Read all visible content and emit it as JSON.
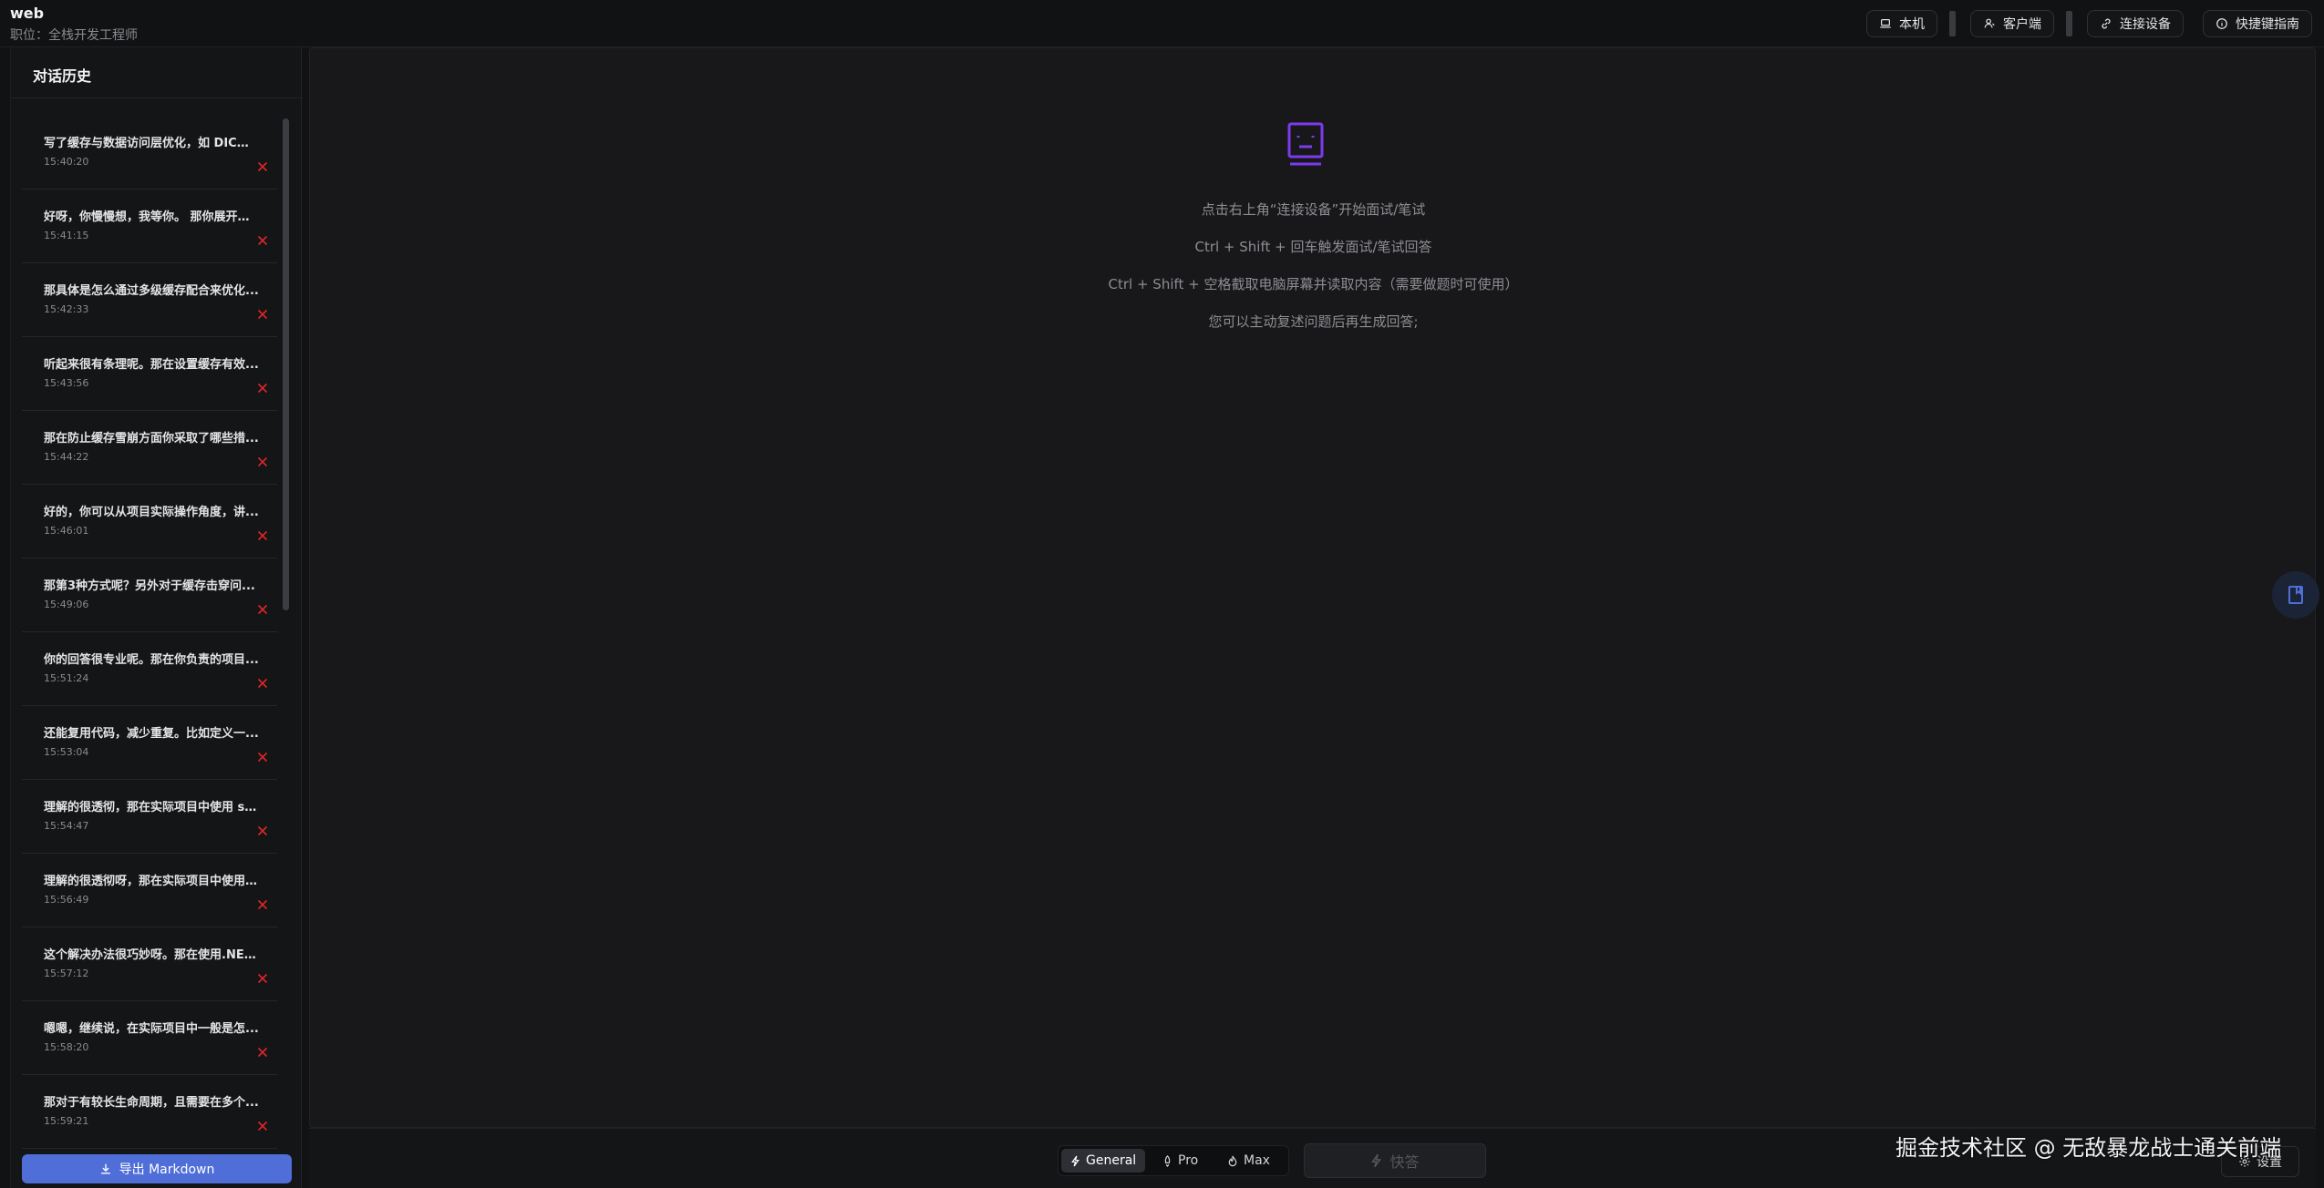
{
  "header": {
    "app_title": "web",
    "job_title": "职位：全栈开发工程师",
    "buttons": {
      "local": "本机",
      "client": "客户端",
      "connect": "连接设备",
      "shortcuts": "快捷键指南"
    }
  },
  "sidebar": {
    "title": "对话历史",
    "items": [
      {
        "text": "写了缓存与数据访问层优化，如 DICM...",
        "time": "15:40:20"
      },
      {
        "text": "好呀，你慢慢想，我等你。 那你展开说...",
        "time": "15:41:15"
      },
      {
        "text": "那具体是怎么通过多级缓存配合来优化...",
        "time": "15:42:33"
      },
      {
        "text": "听起来很有条理呢。那在设置缓存有效...",
        "time": "15:43:56"
      },
      {
        "text": "那在防止缓存雪崩方面你采取了哪些措...",
        "time": "15:44:22"
      },
      {
        "text": "好的，你可以从项目实际操作角度，讲...",
        "time": "15:46:01"
      },
      {
        "text": "那第3种方式呢？另外对于缓存击穿问...",
        "time": "15:49:06"
      },
      {
        "text": "你的回答很专业呢。那在你负责的项目...",
        "time": "15:51:24"
      },
      {
        "text": "还能复用代码，减少重复。比如定义一...",
        "time": "15:53:04"
      },
      {
        "text": "理解的很透彻，那在实际项目中使用 s t...",
        "time": "15:54:47"
      },
      {
        "text": "理解的很透彻呀，那在实际项目中使用 ...",
        "time": "15:56:49"
      },
      {
        "text": "这个解决办法很巧妙呀。那在使用.NET ...",
        "time": "15:57:12"
      },
      {
        "text": "嗯嗯，继续说，在实际项目中一般是怎...",
        "time": "15:58:20"
      },
      {
        "text": "那对于有较长生命周期，且需要在多个...",
        "time": "15:59:21"
      }
    ],
    "export_label": "导出 Markdown"
  },
  "main": {
    "hints": [
      "点击右上角“连接设备”开始面试/笔试",
      "Ctrl + Shift + 回车触发面试/笔试回答",
      "Ctrl + Shift + 空格截取电脑屏幕并读取内容（需要做题时可使用）",
      "您可以主动复述问题后再生成回答;"
    ]
  },
  "bottom": {
    "modes": [
      "General",
      "Pro",
      "Max"
    ],
    "active_mode": "General",
    "quick_answer": "快答",
    "settings": "设置"
  },
  "watermark": "掘金技术社区 @ 无敌暴龙战士通关前端",
  "colors": {
    "accent": "#4f6ed8",
    "icon_purple": "#7c3aed",
    "delete_red": "#dc2626",
    "background": "#111214"
  },
  "icons": [
    "laptop-icon",
    "user-tie-icon",
    "link-icon",
    "info-icon",
    "robot-icon",
    "close-icon",
    "download-icon",
    "zap-icon",
    "rocket-icon",
    "flame-icon",
    "gear-icon",
    "book-icon"
  ]
}
